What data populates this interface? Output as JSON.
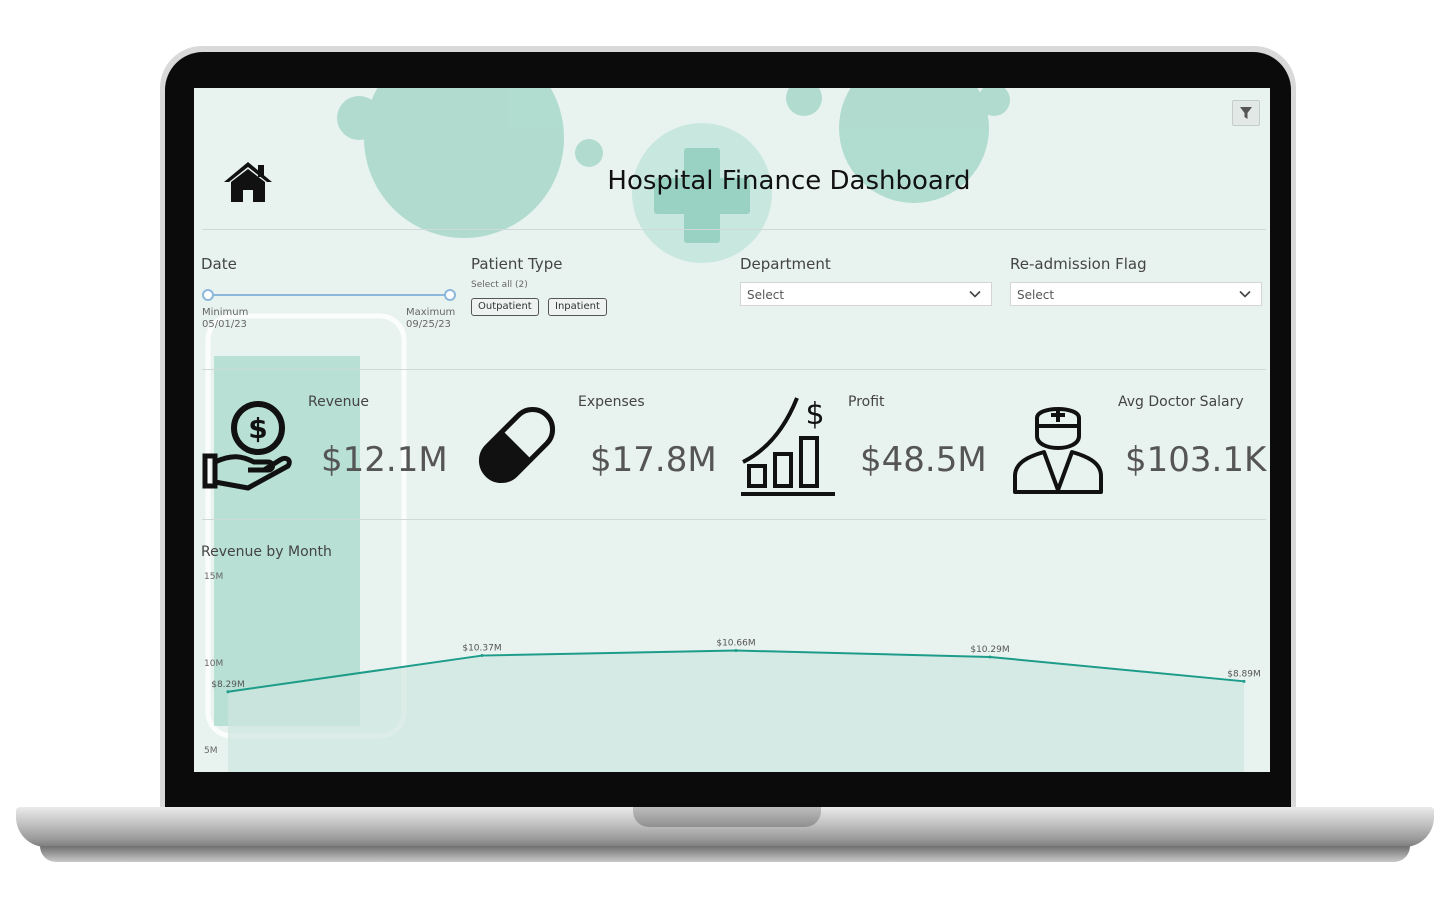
{
  "dashboard": {
    "title": "Hospital Finance Dashboard",
    "filter_icon": "filter-icon",
    "home_icon": "home-icon"
  },
  "filters": {
    "date": {
      "label": "Date",
      "min_label": "Minimum",
      "min_value": "05/01/23",
      "max_label": "Maximum",
      "max_value": "09/25/23"
    },
    "patient_type": {
      "label": "Patient Type",
      "select_all": "Select all (2)",
      "options": [
        "Outpatient",
        "Inpatient"
      ]
    },
    "department": {
      "label": "Department",
      "placeholder": "Select"
    },
    "readmission": {
      "label": "Re-admission Flag",
      "placeholder": "Select"
    }
  },
  "kpis": [
    {
      "label": "Revenue",
      "value": "$12.1M",
      "icon": "money-hand-icon"
    },
    {
      "label": "Expenses",
      "value": "$17.8M",
      "icon": "pill-icon"
    },
    {
      "label": "Profit",
      "value": "$48.5M",
      "icon": "growth-chart-icon"
    },
    {
      "label": "Avg Doctor Salary",
      "value": "$103.1K",
      "icon": "doctor-icon"
    }
  ],
  "colors": {
    "background": "#e8f3f0",
    "accent": "#1e9c8a",
    "area_fill": "#cfe5df",
    "slider": "#8db8dc"
  },
  "chart_data": {
    "type": "line",
    "title": "Revenue by Month",
    "y_ticks": [
      "15M",
      "10M",
      "5M"
    ],
    "ylim": [
      5,
      15
    ],
    "x": [
      0,
      1,
      2,
      3,
      4
    ],
    "values": [
      8.29,
      10.37,
      10.66,
      10.29,
      8.89
    ],
    "labels": [
      "$8.29M",
      "$10.37M",
      "$10.66M",
      "$10.29M",
      "$8.89M"
    ],
    "area": true
  }
}
